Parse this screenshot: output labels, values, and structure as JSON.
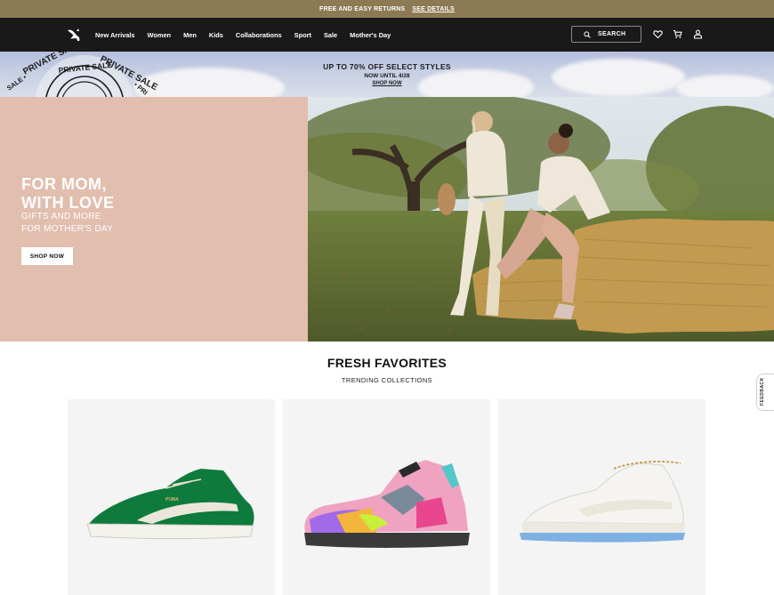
{
  "promo": {
    "text": "FREE AND EASY RETURNS",
    "link": "SEE DETAILS"
  },
  "nav": {
    "logo_icon": "puma-cat-logo-icon",
    "links": [
      "New Arrivals",
      "Women",
      "Men",
      "Kids",
      "Collaborations",
      "Sport",
      "Sale",
      "Mother's Day"
    ],
    "search_label": "SEARCH",
    "icons": [
      "search-icon",
      "heart-icon",
      "cart-icon",
      "account-icon"
    ]
  },
  "sale_banner": {
    "title": "UP TO 70% OFF SELECT STYLES",
    "subtitle": "NOW UNTIL 4/28",
    "cta": "SHOP NOW",
    "stamp_text": "PRIVATE SALE"
  },
  "hero": {
    "title_line1": "FOR MOM,",
    "title_line2": "WITH LOVE",
    "sub_line1": "GIFTS AND MORE",
    "sub_line2": "FOR MOTHER'S DAY",
    "cta": "SHOP NOW",
    "panel_color": "#e2beae"
  },
  "section": {
    "title": "FRESH FAVORITES",
    "subtitle": "TRENDING COLLECTIONS"
  },
  "products": [
    {
      "name": "green suede sneaker",
      "color": "#0e7a3c"
    },
    {
      "name": "multicolor chunky sneaker",
      "color": "#e8478f"
    },
    {
      "name": "white platform sneaker",
      "color": "#7fb0e3"
    }
  ],
  "feedback": {
    "label": "FEEDBACK"
  },
  "colors": {
    "promo_bg": "#8c7a55",
    "nav_bg": "#191919"
  }
}
